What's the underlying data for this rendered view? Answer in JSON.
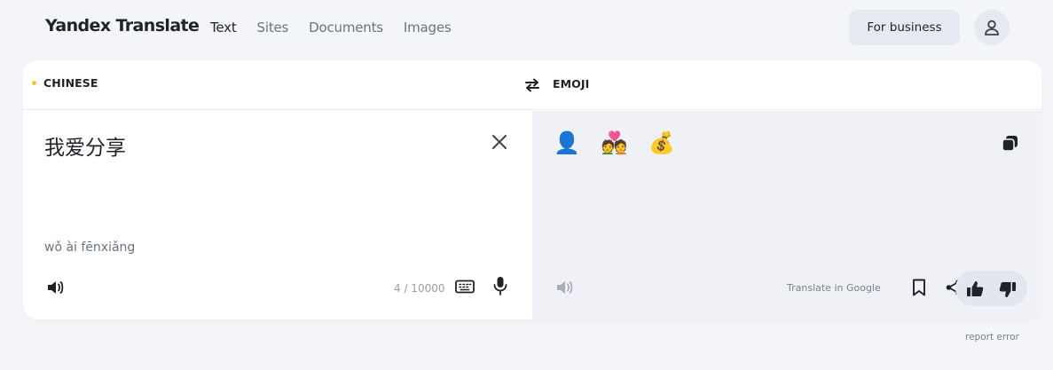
{
  "app": {
    "title": "Yandex Translate"
  },
  "nav": {
    "items": [
      {
        "label": "Text",
        "active": true
      },
      {
        "label": "Sites"
      },
      {
        "label": "Documents"
      },
      {
        "label": "Images"
      }
    ]
  },
  "header": {
    "business_label": "For business",
    "avatar_icon": "user-icon"
  },
  "languages": {
    "source": "CHINESE",
    "target": "EMOJI",
    "swap_icon": "swap-arrows-icon"
  },
  "source": {
    "text": "我爱分享",
    "transliteration": "wǒ ài fēnxiǎng",
    "counter": "4 / 10000",
    "icons": [
      "close-icon",
      "speaker-icon",
      "keyboard-icon",
      "microphone-icon"
    ]
  },
  "target": {
    "text": "👤 💑 💰",
    "google_link": "Translate in Google",
    "icons": [
      "copy-icon",
      "speaker-icon",
      "bookmark-icon",
      "share-icon",
      "thumbs-up-icon",
      "thumbs-down-icon"
    ]
  },
  "footer": {
    "report_label": "report error"
  },
  "colors": {
    "accent_dot": "#f5c33b",
    "card_bg": "#ffffff",
    "result_bg": "#f0f1f6",
    "page_bg": "#f4f5f9"
  }
}
